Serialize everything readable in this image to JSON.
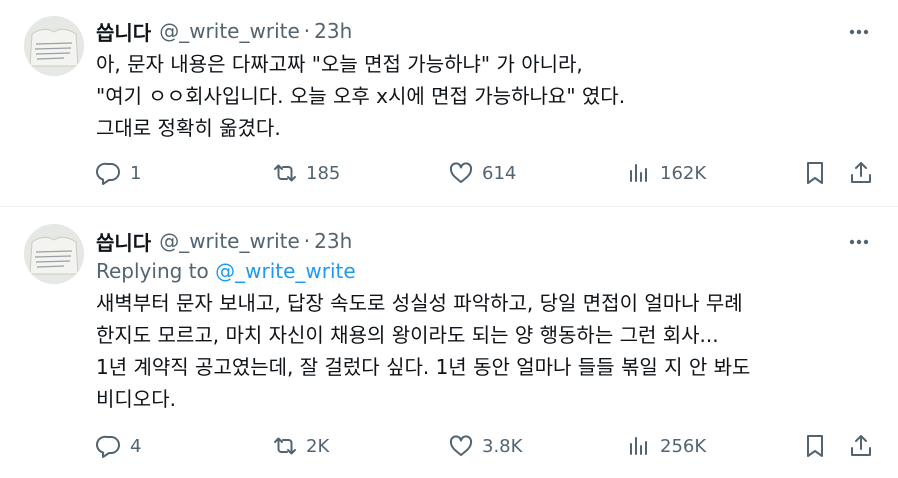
{
  "tweets": [
    {
      "author_name": "씁니다",
      "handle": "@_write_write",
      "separator": "·",
      "time": "23h",
      "lines": [
        "아, 문자 내용은 다짜고짜 \"오늘 면접 가능하냐\" 가 아니라,",
        "\"여기 ㅇㅇ회사입니다. 오늘 오후 x시에 면접 가능하나요\" 였다.",
        "그대로 정확히 옮겼다."
      ],
      "replies": "1",
      "retweets": "185",
      "likes": "614",
      "views": "162K",
      "icons": [
        "more-icon",
        "reply-icon",
        "retweet-icon",
        "like-icon",
        "views-icon",
        "bookmark-icon",
        "share-icon"
      ]
    },
    {
      "author_name": "씁니다",
      "handle": "@_write_write",
      "separator": "·",
      "time": "23h",
      "replying_prefix": "Replying to",
      "replying_handle": "@_write_write",
      "lines": [
        "새벽부터 문자 보내고, 답장 속도로 성실성 파악하고, 당일 면접이 얼마나 무례",
        "한지도 모르고, 마치 자신이 채용의 왕이라도 되는 양 행동하는 그런 회사...",
        "1년 계약직 공고였는데, 잘 걸렀다 싶다. 1년 동안 얼마나 들들 볶일 지 안 봐도",
        "비디오다."
      ],
      "replies": "4",
      "retweets": "2K",
      "likes": "3.8K",
      "views": "256K",
      "icons": [
        "more-icon",
        "reply-icon",
        "retweet-icon",
        "like-icon",
        "views-icon",
        "bookmark-icon",
        "share-icon"
      ]
    }
  ],
  "colors": {
    "text": "#0f1419",
    "muted": "#536471",
    "link": "#1d9bf0",
    "divider": "#eff3f4"
  }
}
